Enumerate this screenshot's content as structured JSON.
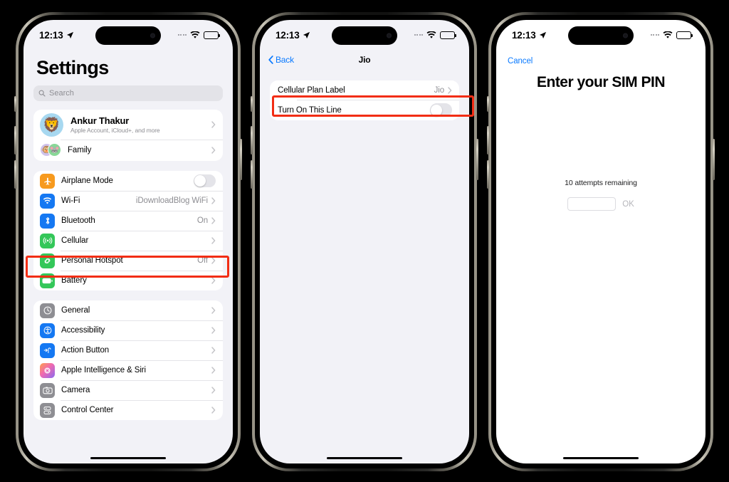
{
  "background_color": "#000000",
  "accent_blue": "#0a7aff",
  "highlight_color": "#f22d14",
  "status_bar": {
    "time": "12:13",
    "location_icon": "location-arrow-icon",
    "cellular_icon": "cellular-dots-icon",
    "wifi_icon": "wifi-icon",
    "battery_icon": "battery-icon",
    "battery_level_percent": 40
  },
  "phone1": {
    "title": "Settings",
    "search": {
      "placeholder": "Search",
      "icon": "search-icon"
    },
    "profile": {
      "name": "Ankur Thakur",
      "subtitle": "Apple Account, iCloud+, and more",
      "avatar": "🦁"
    },
    "family": {
      "label": "Family",
      "avatar_a": "🐵",
      "avatar_b": "🐭"
    },
    "group_connectivity": [
      {
        "label": "Airplane Mode",
        "icon": "airplane-icon",
        "icon_color": "#f79a1e",
        "control": "toggle",
        "toggle_on": false
      },
      {
        "label": "Wi-Fi",
        "icon": "wifi-icon",
        "icon_color": "#1578f2",
        "value": "iDownloadBlog WiFi",
        "control": "chevron"
      },
      {
        "label": "Bluetooth",
        "icon": "bluetooth-icon",
        "icon_color": "#1578f2",
        "value": "On",
        "control": "chevron"
      },
      {
        "label": "Cellular",
        "icon": "cellular-signal-icon",
        "icon_color": "#34c759",
        "value": "",
        "control": "chevron",
        "highlighted": true
      },
      {
        "label": "Personal Hotspot",
        "icon": "hotspot-icon",
        "icon_color": "#34c759",
        "value": "Off",
        "control": "chevron"
      },
      {
        "label": "Battery",
        "icon": "battery-icon",
        "icon_color": "#34c759",
        "value": "",
        "control": "chevron"
      }
    ],
    "group_system": [
      {
        "label": "General",
        "icon": "gear-icon",
        "icon_color": "#8e8e93"
      },
      {
        "label": "Accessibility",
        "icon": "accessibility-icon",
        "icon_color": "#1578f2"
      },
      {
        "label": "Action Button",
        "icon": "action-button-icon",
        "icon_color": "#1578f2"
      },
      {
        "label": "Apple Intelligence & Siri",
        "icon": "siri-icon",
        "icon_color": "#f06ab0"
      },
      {
        "label": "Camera",
        "icon": "camera-icon",
        "icon_color": "#8e8e93"
      },
      {
        "label": "Control Center",
        "icon": "control-center-icon",
        "icon_color": "#8e8e93"
      }
    ]
  },
  "phone2": {
    "nav": {
      "back_label": "Back",
      "title": "Jio",
      "back_icon": "chevron-left-icon"
    },
    "rows": [
      {
        "label": "Cellular Plan Label",
        "value": "Jio",
        "control": "chevron"
      },
      {
        "label": "Turn On This Line",
        "control": "toggle",
        "toggle_on": false,
        "highlighted": true
      }
    ]
  },
  "phone3": {
    "cancel_label": "Cancel",
    "title": "Enter your SIM PIN",
    "attempts_text": "10 attempts remaining",
    "pin_value": "",
    "ok_label": "OK"
  }
}
